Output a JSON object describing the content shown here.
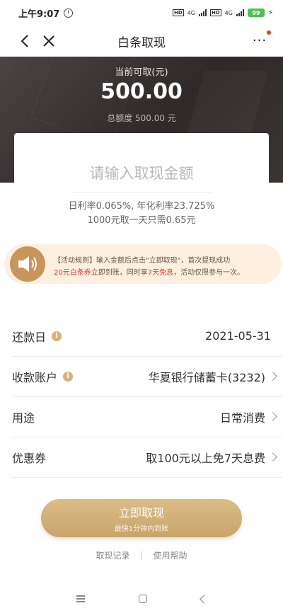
{
  "status": {
    "time": "上午9:07",
    "network1": "4G",
    "network2": "4G",
    "hd1": "HD",
    "hd2": "HD",
    "battery": "99"
  },
  "nav": {
    "title": "白条取现",
    "more": "···"
  },
  "hero": {
    "label": "当前可取(元)",
    "amount": "500.00",
    "total": "总额度 500.00 元"
  },
  "card": {
    "input_placeholder": "请输入取现金额",
    "rate_line1": "日利率0.065%, 年化利率23.725%",
    "rate_line2": "1000元取一天只需0.65元"
  },
  "promo": {
    "line1": "【活动规则】输入金额后点击\"立即取现\"，首次提现成功",
    "line2_highlight1": "20元白条券",
    "line2_mid": "立即到账，同时享",
    "line2_highlight2": "7天免息",
    "line2_end": "，活动仅限参与一次。"
  },
  "rows": [
    {
      "label": "还款日",
      "value": "2021-05-31"
    },
    {
      "label": "收款账户",
      "value": "华夏银行储蓄卡(3232)"
    },
    {
      "label": "用途",
      "value": "日常消费"
    },
    {
      "label": "优惠券",
      "value": "取100元以上免7天息费"
    }
  ],
  "cta": {
    "main": "立即取现",
    "sub": "最快1分钟内到账"
  },
  "links": {
    "records": "取现记录",
    "help": "使用帮助"
  },
  "colors": {
    "accent": "#c9a56a",
    "hero_bg": "#352f2e",
    "promo_bg": "#fdf0e0",
    "highlight_red": "#e03c2b"
  }
}
